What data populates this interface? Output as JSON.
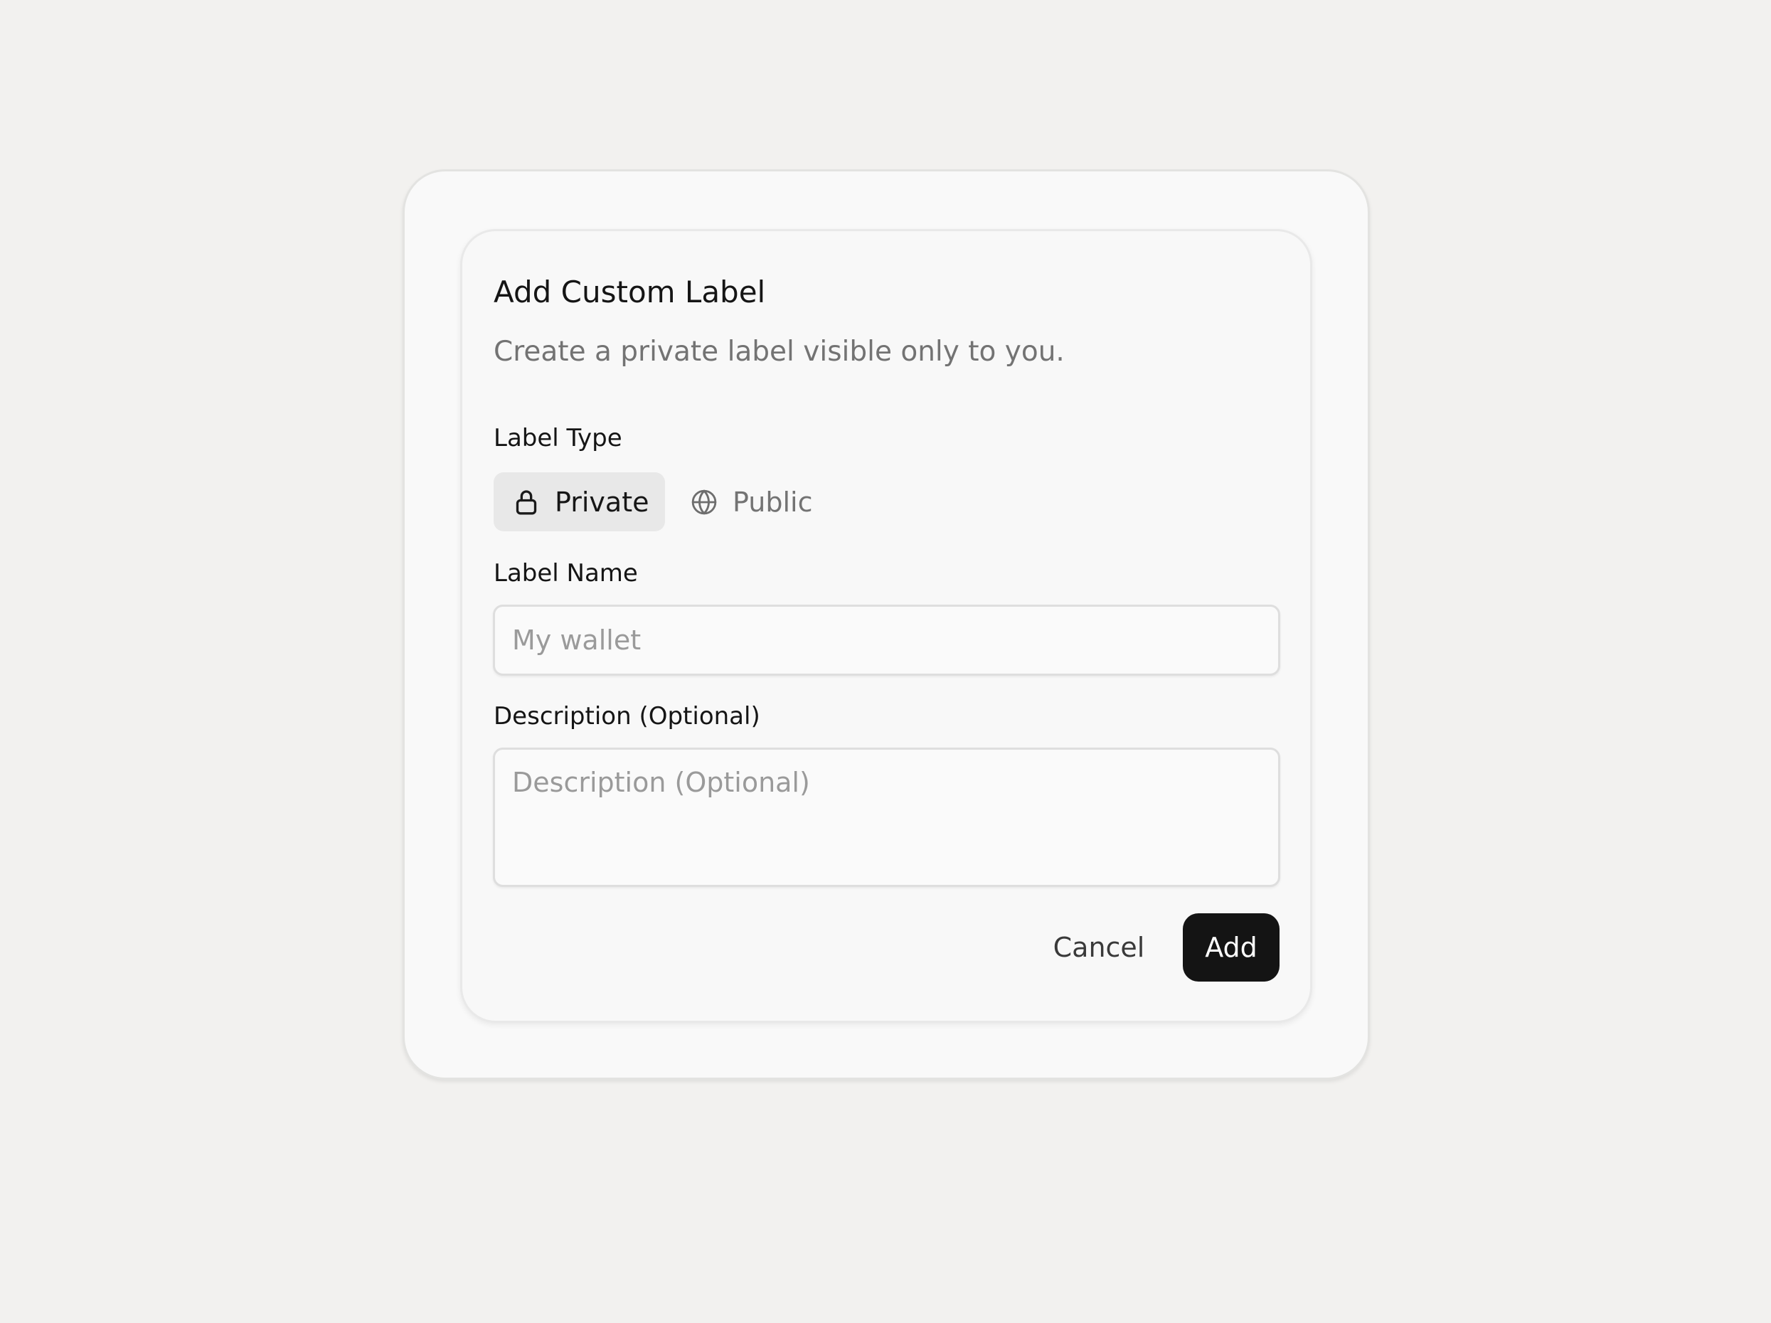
{
  "dialog": {
    "title": "Add Custom Label",
    "subtitle": "Create a private label visible only to you."
  },
  "label_type": {
    "label": "Label Type",
    "options": [
      {
        "label": "Private",
        "icon": "lock-icon",
        "selected": true
      },
      {
        "label": "Public",
        "icon": "globe-icon",
        "selected": false
      }
    ]
  },
  "label_name": {
    "label": "Label Name",
    "value": "",
    "placeholder": "My wallet"
  },
  "description": {
    "label": "Description (Optional)",
    "value": "",
    "placeholder": "Description (Optional)"
  },
  "actions": {
    "cancel_label": "Cancel",
    "add_label": "Add"
  },
  "colors": {
    "page_background": "#f2f1ef",
    "card_background": "#f9f9f9",
    "selected_option_background": "#e8e8e8",
    "primary_button": "#141414",
    "muted_text": "#737373",
    "placeholder_text": "#9a9a9a"
  }
}
